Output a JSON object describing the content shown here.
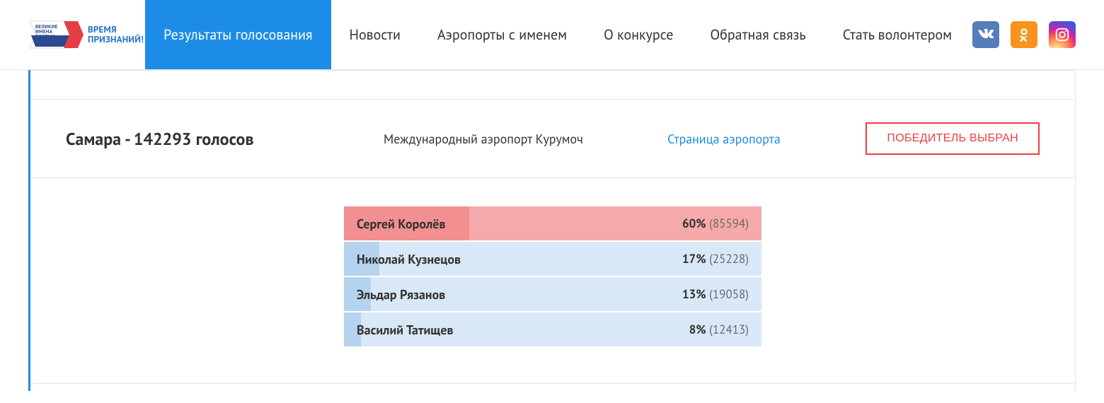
{
  "logo": {
    "lines": "ВЕЛИКИЕ\nИМЕНА\nРОССИИ",
    "slogan_l1": "ВРЕМЯ",
    "slogan_l2": "ПРИЗНАНИЙ!"
  },
  "nav": {
    "results": "Результаты голосования",
    "news": "Новости",
    "airports_named": "Аэропорты с именем",
    "about": "О конкурсе",
    "feedback": "Обратная связь",
    "volunteer": "Стать волонтером"
  },
  "card": {
    "city_line": "Самара - 142293 голосов",
    "airport": "Международный аэропорт Курумоч",
    "page_link": "Страница аэропорта",
    "winner_btn": "ПОБЕДИТЕЛЬ ВЫБРАН"
  },
  "chart_data": {
    "type": "bar",
    "title": "Самара - 142293 голосов",
    "xlabel": "",
    "ylabel": "",
    "categories": [
      "Сергей Королёв",
      "Николай Кузнецов",
      "Эльдар Рязанов",
      "Василий Татищев"
    ],
    "series": [
      {
        "name": "percent",
        "values": [
          60,
          17,
          13,
          8
        ]
      },
      {
        "name": "votes",
        "values": [
          85594,
          25228,
          19058,
          12413
        ]
      }
    ],
    "winner_index": 0,
    "ylim": [
      0,
      100
    ]
  }
}
